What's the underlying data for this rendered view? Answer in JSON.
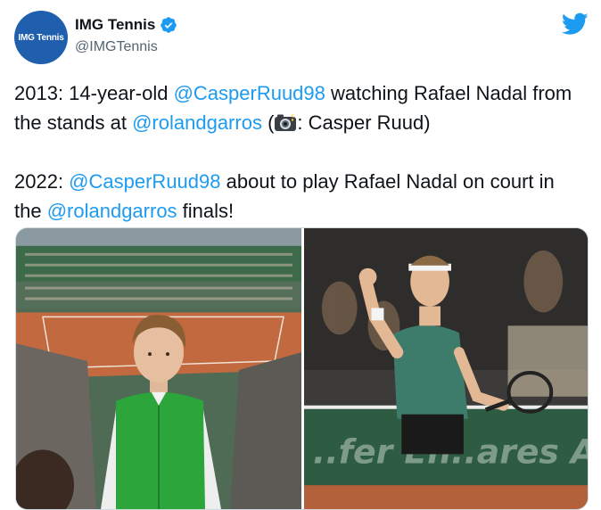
{
  "account": {
    "avatar_text": "IMG Tennis",
    "display_name": "IMG Tennis",
    "handle": "@IMGTennis",
    "verified": true
  },
  "icons": {
    "verified": "verified-badge-icon",
    "brand": "twitter-bird-icon",
    "camera": "camera-flash-emoji"
  },
  "tweet": {
    "p1_prefix": "2013: 14-year-old ",
    "p1_mention1": "@CasperRuud98",
    "p1_mid": " watching Rafael Nadal from the stands at ",
    "p1_mention2": "@rolandgarros",
    "p1_open": " (",
    "p1_suffix": ": Casper Ruud)",
    "p2_prefix": "2022: ",
    "p2_mention1": "@CasperRuud98",
    "p2_mid": " about to play Rafael Nadal on court in the ",
    "p2_mention2": "@rolandgarros",
    "p2_suffix": " finals!"
  },
  "colors": {
    "link": "#1d9bf0",
    "brand_blue": "#1d9bf0",
    "avatar_bg": "#1f5fae"
  }
}
